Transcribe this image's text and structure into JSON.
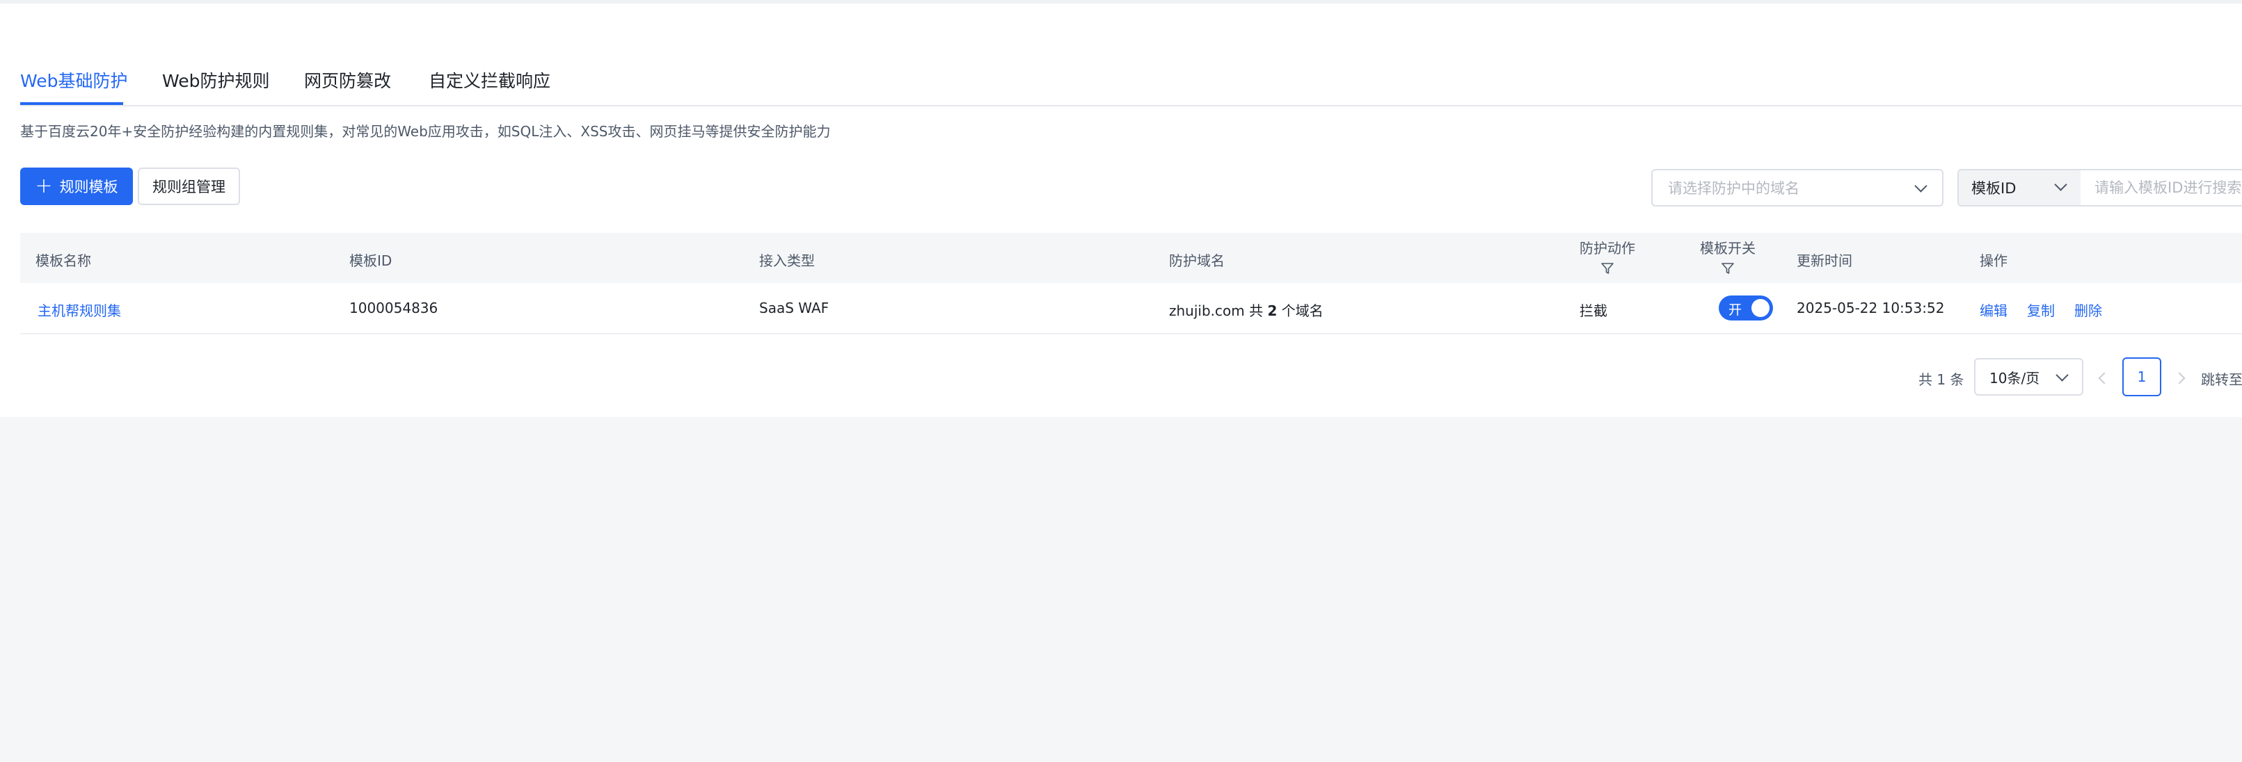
{
  "tabs": [
    {
      "label": "Web基础防护",
      "active": true
    },
    {
      "label": "Web防护规则",
      "active": false
    },
    {
      "label": "网页防篡改",
      "active": false
    },
    {
      "label": "自定义拦截响应",
      "active": false
    }
  ],
  "description": "基于百度云20年+安全防护经验构建的内置规则集，对常见的Web应用攻击，如SQL注入、XSS攻击、网页挂马等提供安全防护能力",
  "toolbar": {
    "add_template_label": "规则模板",
    "group_manage_label": "规则组管理",
    "domain_select_placeholder": "请选择防护中的域名",
    "search_type": "模板ID",
    "search_placeholder": "请输入模板ID进行搜索"
  },
  "table": {
    "columns": {
      "name": "模板名称",
      "id": "模板ID",
      "access_type": "接入类型",
      "domain": "防护域名",
      "action": "防护动作",
      "switch": "模板开关",
      "updated": "更新时间",
      "operations": "操作"
    },
    "rows": [
      {
        "name": "主机帮规则集",
        "id": "1000054836",
        "access_type": "SaaS WAF",
        "domain_prefix": "zhujib.com 共 ",
        "domain_count": "2",
        "domain_suffix": " 个域名",
        "action": "拦截",
        "switch_label": "开",
        "switch_on": true,
        "updated": "2025-05-22 10:53:52",
        "ops": {
          "edit": "编辑",
          "copy": "复制",
          "delete": "删除"
        }
      }
    ]
  },
  "pagination": {
    "total": "共 1 条",
    "page_size": "10条/页",
    "current_page": "1",
    "jump_label": "跳转至"
  },
  "colors": {
    "accent": "#2468f2",
    "background": "#f5f6f8"
  }
}
